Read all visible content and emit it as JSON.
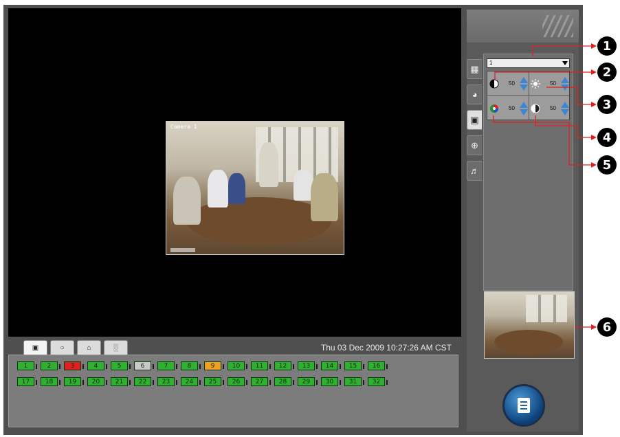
{
  "video": {
    "camera_label": "Camera 1"
  },
  "bottom_bar": {
    "tabs": [
      {
        "icon": "camera-tab-icon"
      },
      {
        "icon": "ptz-tab-icon"
      },
      {
        "icon": "home-tab-icon"
      },
      {
        "icon": "user-tab-icon"
      }
    ],
    "datetime": "Thu 03 Dec 2009 10:27:26 AM CST"
  },
  "channels": {
    "row1": [
      "1",
      "2",
      "3",
      "4",
      "5",
      "6",
      "7",
      "8",
      "9",
      "10",
      "11",
      "12",
      "13",
      "14",
      "15",
      "16"
    ],
    "row2": [
      "17",
      "18",
      "19",
      "20",
      "21",
      "22",
      "23",
      "24",
      "25",
      "26",
      "27",
      "28",
      "29",
      "30",
      "31",
      "32"
    ],
    "colors": {
      "active": "#30b030",
      "alarm": "#e02020",
      "idle": "#c8c8c8",
      "motion": "#f0a020"
    }
  },
  "side_panel": {
    "camera_select": "1",
    "adjustments": {
      "contrast": "50",
      "brightness": "50",
      "color": "50",
      "sharpness": "50"
    },
    "vertical_tabs": [
      "layout-icon",
      "ptz-icon",
      "image-icon",
      "zoom-icon",
      "audio-icon"
    ]
  },
  "callouts": [
    "1",
    "2",
    "3",
    "4",
    "5",
    "6"
  ],
  "accent": "#e02020"
}
